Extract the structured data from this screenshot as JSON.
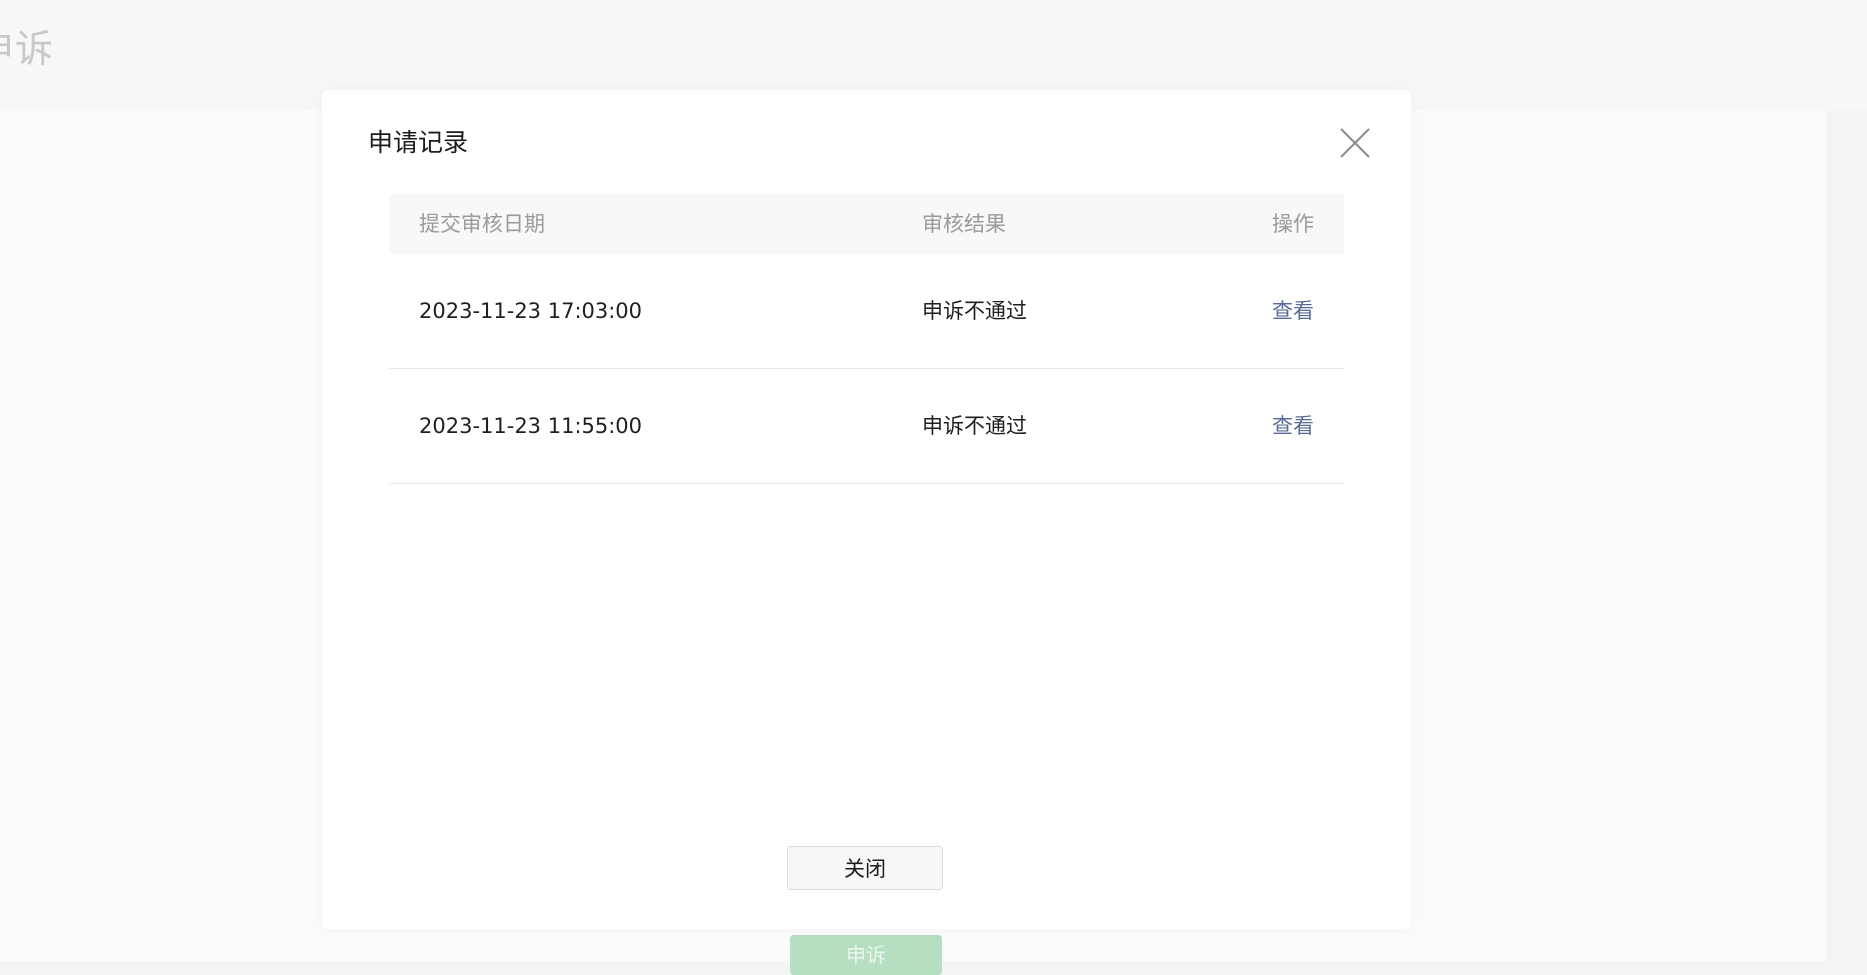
{
  "page": {
    "title": "申诉",
    "action_button_label": "申诉"
  },
  "dialog": {
    "title": "申请记录",
    "close_icon": "close-icon",
    "table": {
      "headers": {
        "date": "提交审核日期",
        "result": "审核结果",
        "action": "操作"
      },
      "rows": [
        {
          "date": "2023-11-23 17:03:00",
          "result": "申诉不通过",
          "action": "查看"
        },
        {
          "date": "2023-11-23 11:55:00",
          "result": "申诉不通过",
          "action": "查看"
        }
      ]
    },
    "close_button_label": "关闭"
  },
  "colors": {
    "link": "#576b95",
    "action_button": "#b6dec1"
  }
}
